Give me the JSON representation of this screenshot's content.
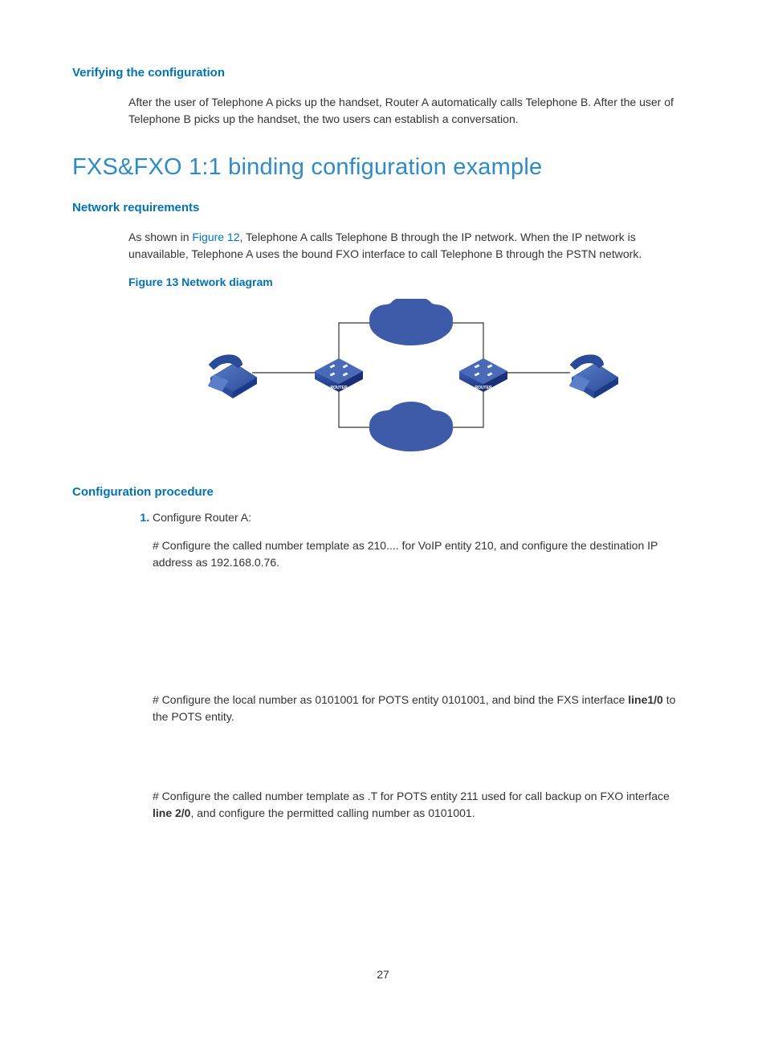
{
  "sec1": {
    "heading": "Verifying the configuration",
    "para": "After the user of Telephone A picks up the handset, Router A automatically calls Telephone B. After the user of Telephone B picks up the handset, the two users can establish a conversation."
  },
  "title": "FXS&FXO 1:1 binding configuration example",
  "sec2": {
    "heading": "Network requirements",
    "para_pre": "As shown in ",
    "link": "Figure 12",
    "para_post": ", Telephone A calls Telephone B through the IP network. When the IP network is unavailable, Telephone A uses the bound FXO interface to call Telephone B through the PSTN network."
  },
  "fig_caption": "Figure 13 Network diagram",
  "diagram": {
    "router_label": "ROUTER"
  },
  "sec3": {
    "heading": "Configuration procedure",
    "ol1": "Configure Router A:",
    "step1": "# Configure the called number template as 210.... for VoIP entity 210, and configure the destination IP address as 192.168.0.76.",
    "step2_a": "# Configure the local number as 0101001 for POTS entity 0101001, and bind the FXS interface ",
    "step2_bold": "line1/0",
    "step2_b": " to the POTS entity.",
    "step3_a": "# Configure the called number template as .T for POTS entity 211 used for call backup on FXO interface ",
    "step3_bold": "line 2/0",
    "step3_b": ", and configure the permitted calling number as 0101001."
  },
  "page_num": "27"
}
